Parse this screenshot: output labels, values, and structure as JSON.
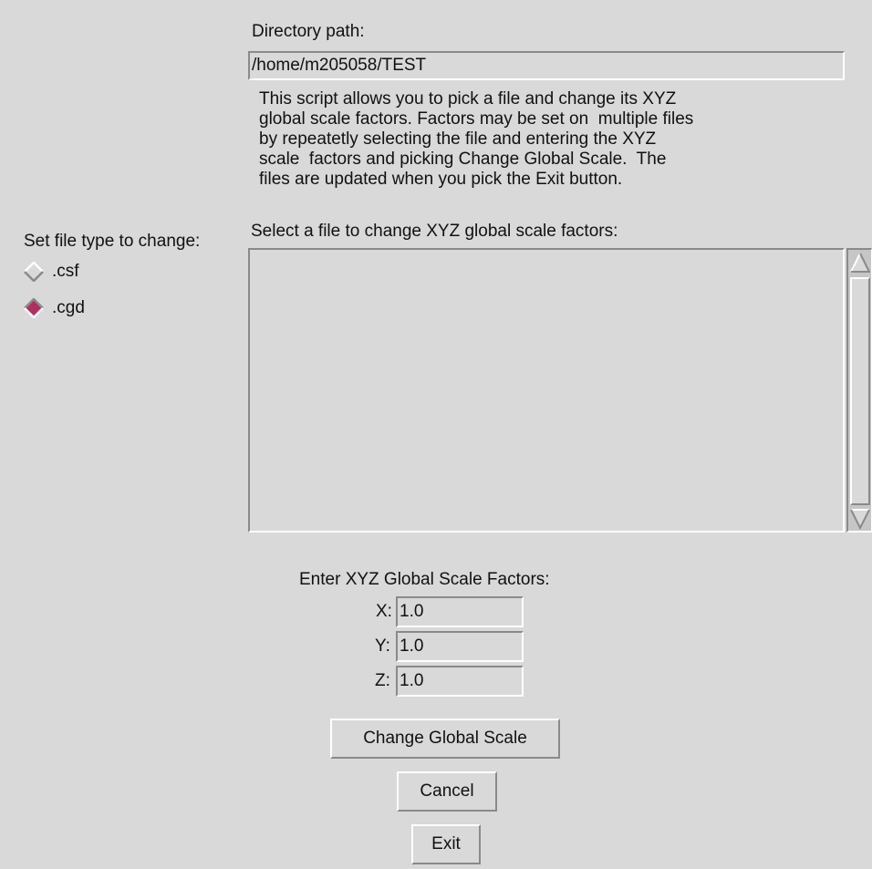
{
  "directory": {
    "label": "Directory path:",
    "value": "/home/m205058/TEST"
  },
  "description": {
    "lines": [
      "This script allows you to pick a file and change its XYZ",
      "global scale factors. Factors may be set on  multiple files",
      "by repeatetly selecting the file and entering the XYZ",
      "scale  factors and picking Change Global Scale.  The",
      "files are updated when you pick the Exit button."
    ]
  },
  "file_type": {
    "label": "Set file type to change:",
    "options": [
      {
        "label": ".csf",
        "selected": false
      },
      {
        "label": ".cgd",
        "selected": true
      }
    ],
    "selected_color": "#b03060"
  },
  "file_list": {
    "label": "Select a file to change XYZ global scale factors:",
    "items": []
  },
  "scale": {
    "heading": "Enter XYZ Global Scale Factors:",
    "x_label": "X:",
    "x_value": "1.0",
    "y_label": "Y:",
    "y_value": "1.0",
    "z_label": "Z:",
    "z_value": "1.0"
  },
  "buttons": {
    "change_label": "Change Global Scale",
    "cancel_label": "Cancel",
    "exit_label": "Exit"
  }
}
